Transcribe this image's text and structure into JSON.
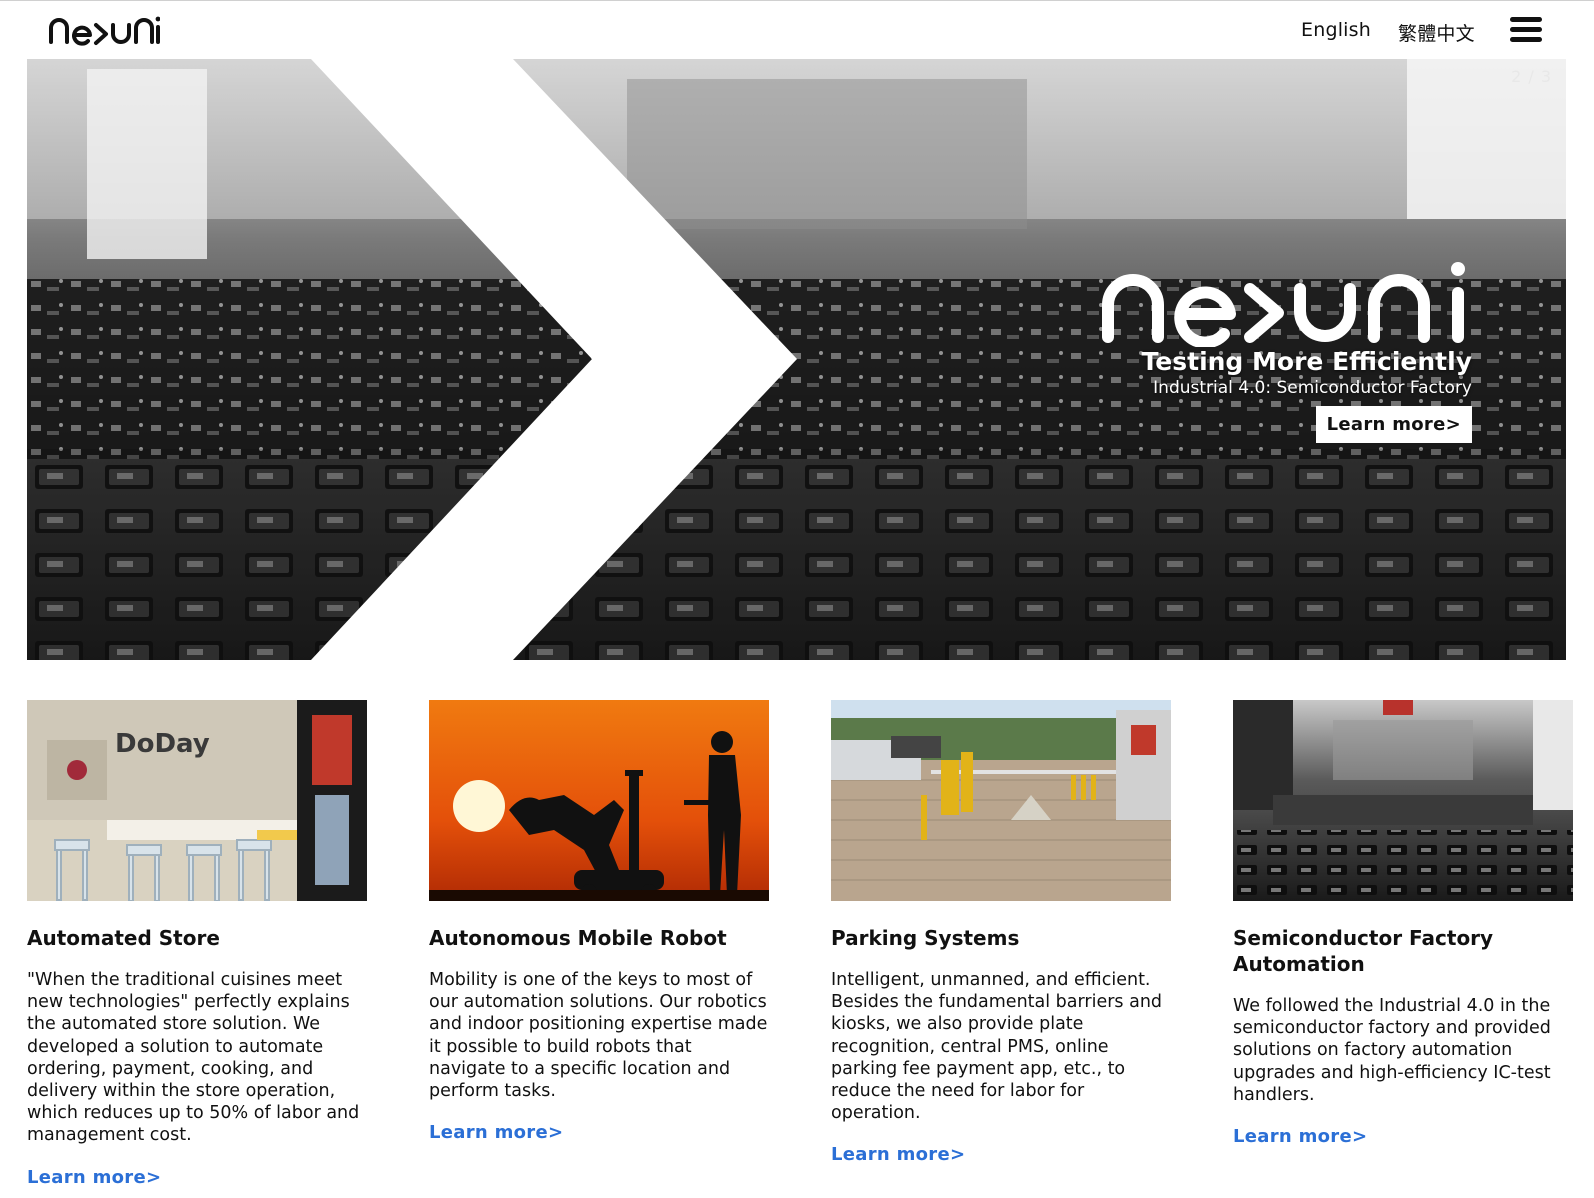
{
  "header": {
    "logo_text": "ne>uni",
    "languages": [
      "English",
      "繁體中文"
    ],
    "menu_icon": "hamburger-menu-icon"
  },
  "hero": {
    "slide_counter": "2 / 3",
    "logo_text": "ne>uni",
    "title": "Testing More Efficiently",
    "subtitle": "Industrial 4.0: Semiconductor Factory",
    "button_label": "Learn more>"
  },
  "cards": [
    {
      "image_alt": "Automated store with bar stools and DoDay sign",
      "sign_text": "DoDay",
      "title": "Automated Store",
      "text": "\"When the traditional cuisines meet new technologies\" perfectly explains the automated store solution. We developed a solution to automate ordering, payment, cooking, and delivery within the store operation, which reduces up to 50% of labor and management cost.",
      "link": "Learn more>"
    },
    {
      "image_alt": "Silhouette of robot arm and man against orange sunset",
      "title": "Autonomous Mobile Robot",
      "text": "Mobility is one of the keys to most of our automation solutions. Our robotics and indoor positioning expertise made it possible to build robots that navigate to a specific location and perform tasks.",
      "link": "Learn more>"
    },
    {
      "image_alt": "Parking lot with yellow barriers and kiosk",
      "title": "Parking Systems",
      "text": "Intelligent, unmanned, and efficient. Besides the fundamental barriers and kiosks, we also provide plate recognition, central PMS, online parking fee payment app, etc., to reduce the need for labor for operation.",
      "link": "Learn more>"
    },
    {
      "image_alt": "Black and white semiconductor factory machinery",
      "title": "Semiconductor Factory Automation",
      "text": "We followed the Industrial 4.0 in the semiconductor factory and provided solutions on factory automation upgrades and high-efficiency IC-test handlers.",
      "link": "Learn more>"
    }
  ],
  "colors": {
    "link": "#2b6fd6",
    "text": "#111111",
    "background": "#ffffff"
  }
}
